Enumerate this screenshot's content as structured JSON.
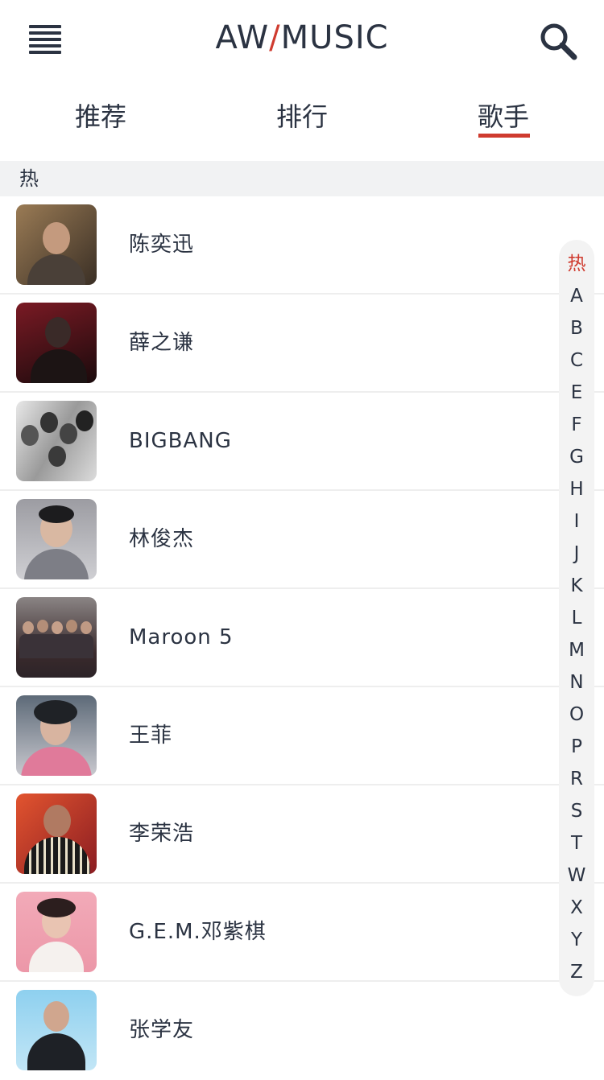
{
  "header": {
    "logo_left": "AW",
    "logo_slash": "/",
    "logo_right": "MUSIC"
  },
  "tabs": [
    {
      "label": "推荐"
    },
    {
      "label": "排行"
    },
    {
      "label": "歌手"
    }
  ],
  "active_tab": "歌手",
  "section": {
    "title": "热"
  },
  "artists": [
    {
      "name": "陈奕迅"
    },
    {
      "name": "薛之谦"
    },
    {
      "name": "BIGBANG"
    },
    {
      "name": "林俊杰"
    },
    {
      "name": "Maroon 5"
    },
    {
      "name": "王菲"
    },
    {
      "name": "李荣浩"
    },
    {
      "name": "G.E.M.邓紫棋"
    },
    {
      "name": "张学友"
    }
  ],
  "index": [
    "热",
    "A",
    "B",
    "C",
    "E",
    "F",
    "G",
    "H",
    "I",
    "J",
    "K",
    "L",
    "M",
    "N",
    "O",
    "P",
    "R",
    "S",
    "T",
    "W",
    "X",
    "Y",
    "Z"
  ],
  "active_index": "热",
  "colors": {
    "accent": "#cf3b2f",
    "text": "#2b3342",
    "section_bg": "#f1f2f3",
    "index_bg": "#f3f3f3"
  },
  "icons": {
    "menu": "hamburger-menu-icon",
    "search": "search-icon"
  }
}
